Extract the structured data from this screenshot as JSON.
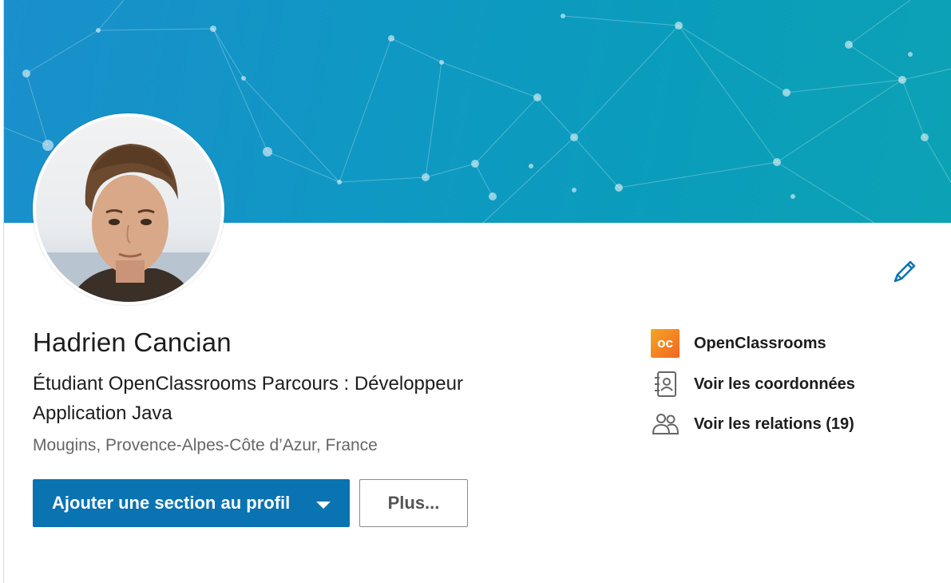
{
  "profile": {
    "name": "Hadrien Cancian",
    "headline": "Étudiant OpenClassrooms Parcours : Développeur Application Java",
    "location": "Mougins, Provence-Alpes-Côte d’Azur, France"
  },
  "actions": {
    "primary_label": "Ajouter une section au profil",
    "secondary_label": "Plus..."
  },
  "sidebar": {
    "items": [
      {
        "label": "OpenClassrooms",
        "icon": "openclassrooms-logo"
      },
      {
        "label": "Voir les coordonnées",
        "icon": "contact-card-icon"
      },
      {
        "label": "Voir les relations (19)",
        "icon": "people-icon"
      }
    ]
  },
  "icons": {
    "edit": "pencil-icon",
    "logo_text": "oc"
  },
  "colors": {
    "primary": "#0a73b1",
    "banner": "#0f98c3",
    "text": "#1d1d1d",
    "muted": "#666666"
  }
}
